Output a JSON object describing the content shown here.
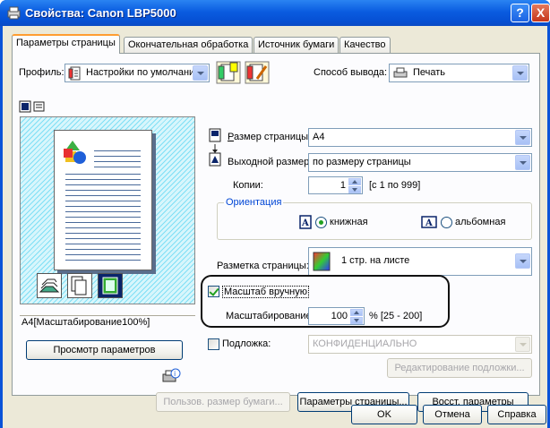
{
  "window": {
    "title": "Свойства: Canon LBP5000",
    "help_btn": "?",
    "close_btn": "X"
  },
  "tabs": [
    {
      "label": "Параметры страницы",
      "active": true
    },
    {
      "label": "Окончательная обработка",
      "active": false
    },
    {
      "label": "Источник бумаги",
      "active": false
    },
    {
      "label": "Качество",
      "active": false
    }
  ],
  "profile": {
    "label": "Профиль:",
    "value": "Настройки по умолчанию"
  },
  "output": {
    "label": "Способ вывода:",
    "value": "Печать"
  },
  "page_size": {
    "label": "Размер страницы:",
    "value": "A4"
  },
  "output_size": {
    "label": "Выходной размер:",
    "value": "по размеру страницы"
  },
  "copies": {
    "label": "Копии:",
    "value": "1",
    "range": "[с 1 по 999]"
  },
  "orientation": {
    "legend": "Ориентация",
    "portrait": "книжная",
    "landscape": "альбомная",
    "selected": "portrait"
  },
  "layout": {
    "label": "Разметка страницы:",
    "value": "1 стр. на листе"
  },
  "manual_scale": {
    "label": "Масштаб вручную",
    "checked": true
  },
  "scaling": {
    "label": "Масштабирование:",
    "value": "100",
    "range": "% [25 - 200]"
  },
  "watermark": {
    "label": "Подложка:",
    "checked": false,
    "value": "КОНФИДЕНЦИАЛЬНО",
    "edit_button": "Редактирование подложки..."
  },
  "preview": {
    "status": "A4[Масштабирование100%]",
    "view_settings_button": "Просмотр параметров"
  },
  "bottom_buttons": {
    "custom_paper": "Пользов. размер бумаги...",
    "page_options": "Параметры страницы...",
    "restore_defaults": "Восст. параметры"
  },
  "dialog_buttons": {
    "ok": "OK",
    "cancel": "Отмена",
    "help": "Справка"
  },
  "colors": {
    "titlebar": "#0a5ce0",
    "dialog_bg": "#ece9d8",
    "panel_bg": "#fcfcfe",
    "accent_tab": "#ff9d31",
    "check_green": "#21a121"
  }
}
